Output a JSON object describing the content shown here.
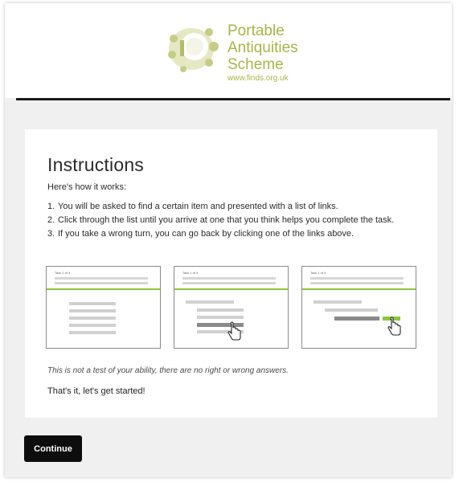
{
  "header": {
    "logo_icon": "brooch-emblem-icon",
    "logo_lines": [
      "Portable",
      "Antiquities",
      "Scheme"
    ],
    "logo_url": "www.finds.org.uk",
    "brand_color": "#a9b34a"
  },
  "card": {
    "title": "Instructions",
    "intro": "Here's how it works:",
    "steps": [
      {
        "num": "1.",
        "text": "You will be asked to find a certain item and presented with a list of links."
      },
      {
        "num": "2.",
        "text": "Click through the list until you arrive at one that you think helps you complete the task."
      },
      {
        "num": "3.",
        "text": "If you take a wrong turn, you can go back by clicking one of the links above."
      }
    ],
    "thumbnails": [
      {
        "label": "Task 1 of 4",
        "icon": "none"
      },
      {
        "label": "Task 1 of 4",
        "icon": "pointer-hand-icon"
      },
      {
        "label": "Task 1 of 4",
        "icon": "pointer-hand-icon"
      }
    ],
    "note": "This is not a test of your ability, there are no right or wrong answers.",
    "start": "That's it, let's get started!"
  },
  "actions": {
    "continue_label": "Continue"
  },
  "colors": {
    "accent_green": "#8cc63f",
    "button_bg": "#0d0d0d"
  }
}
